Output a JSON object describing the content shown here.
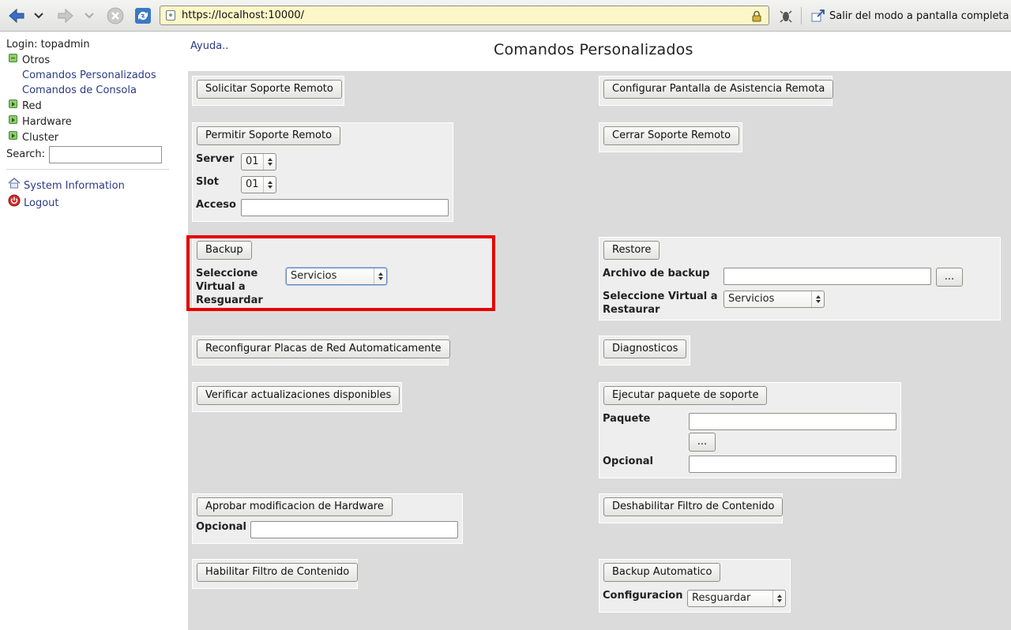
{
  "browser": {
    "url": "https://localhost:10000/",
    "fullscreen_label": "Salir del modo a pantalla completa"
  },
  "sidebar": {
    "login": "Login: topadmin",
    "tree": {
      "otros": "Otros",
      "comandos_personalizados": "Comandos Personalizados",
      "comandos_consola": "Comandos de Consola",
      "red": "Red",
      "hardware": "Hardware",
      "cluster": "Cluster"
    },
    "search_label": "Search:",
    "search_value": "",
    "system_information": "System Information",
    "logout": "Logout"
  },
  "main": {
    "help": "Ayuda..",
    "title": "Comandos Personalizados",
    "solicitar": {
      "button": "Solicitar Soporte Remoto"
    },
    "configurar": {
      "button": "Configurar Pantalla de Asistencia Remota"
    },
    "permitir": {
      "button": "Permitir Soporte Remoto",
      "server_label": "Server",
      "server_value": "01",
      "slot_label": "Slot",
      "slot_value": "01",
      "acceso_label": "Acceso",
      "acceso_value": ""
    },
    "cerrar": {
      "button": "Cerrar Soporte Remoto"
    },
    "backup": {
      "button": "Backup",
      "label": "Seleccione Virtual a Resguardar",
      "value": "Servicios"
    },
    "restore": {
      "button": "Restore",
      "archivo_label": "Archivo de backup",
      "archivo_value": "",
      "browse": "...",
      "virtual_label": "Seleccione Virtual a Restaurar",
      "virtual_value": "Servicios"
    },
    "reconfigurar": {
      "button": "Reconfigurar Placas de Red Automaticamente"
    },
    "diagnosticos": {
      "button": "Diagnosticos"
    },
    "verificar": {
      "button": "Verificar actualizaciones disponibles"
    },
    "ejecutar": {
      "button": "Ejecutar paquete de soporte",
      "paquete_label": "Paquete",
      "paquete_value": "",
      "browse": "...",
      "opcional_label": "Opcional",
      "opcional_value": ""
    },
    "aprobar": {
      "button": "Aprobar modificacion de Hardware",
      "opcional_label": "Opcional",
      "opcional_value": ""
    },
    "deshabilitar": {
      "button": "Deshabilitar Filtro de Contenido"
    },
    "habilitar": {
      "button": "Habilitar Filtro de Contenido"
    },
    "backup_auto": {
      "button": "Backup Automatico",
      "config_label": "Configuracion",
      "config_value": "Resguardar"
    }
  }
}
